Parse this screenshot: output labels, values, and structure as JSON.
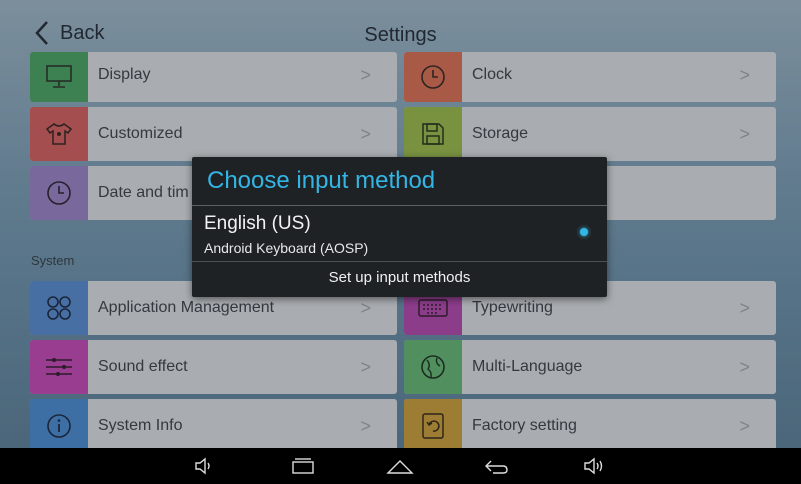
{
  "header": {
    "back_label": "Back",
    "title": "Settings"
  },
  "tiles": {
    "display": "Display",
    "clock": "Clock",
    "customized": "Customized",
    "storage": "Storage",
    "date_time": "Date and tim",
    "app_mgmt": "Application Management",
    "typewriting": "Typewriting",
    "sound": "Sound effect",
    "multilang": "Multi-Language",
    "sysinfo": "System Info",
    "factory": "Factory setting",
    "chevron": ">"
  },
  "section_label": "System",
  "dialog": {
    "title": "Choose input method",
    "option_title": "English (US)",
    "option_subtitle": "Android Keyboard (AOSP)",
    "setup_label": "Set up input methods"
  },
  "colors": {
    "accent": "#33b5e5",
    "display_icon": "#4fa56a",
    "clock_icon": "#d9745a",
    "custom_icon": "#d46566",
    "storage_icon": "#9bbb52",
    "date_icon": "#9a86c8",
    "app_icon": "#5c8fd3",
    "type_icon": "#b24fb0",
    "sound_icon": "#c34fb8",
    "lang_icon": "#69b87a",
    "info_icon": "#4f8fd3",
    "factory_icon": "#c9a142"
  }
}
